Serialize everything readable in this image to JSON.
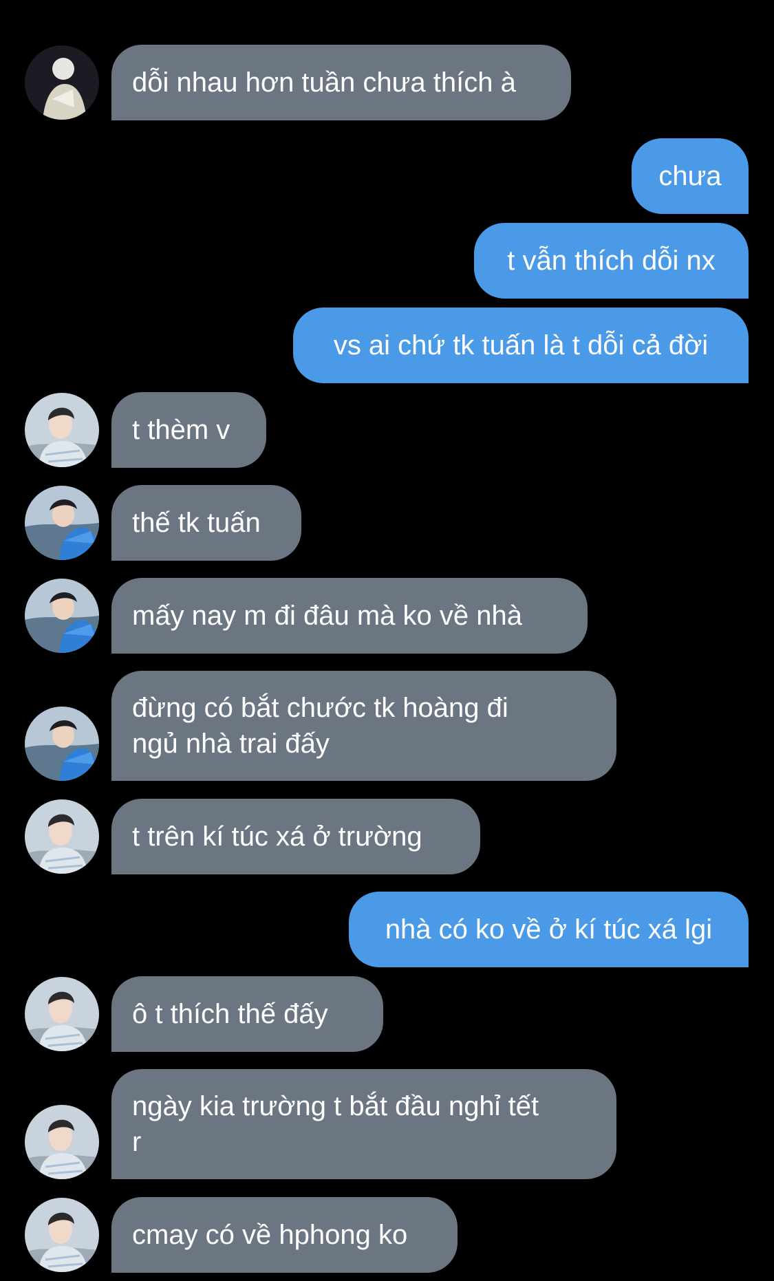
{
  "conversation": {
    "messages": [
      {
        "side": "in",
        "avatar": "avatar-a",
        "text": "dỗi nhau hơn tuần chưa thích à"
      },
      {
        "side": "out",
        "text": "chưa"
      },
      {
        "side": "out",
        "text": "t vẫn thích dỗi nx"
      },
      {
        "side": "out",
        "text": "vs ai chứ tk tuấn là t dỗi cả đời"
      },
      {
        "side": "in",
        "avatar": "avatar-b",
        "text": "t thèm v"
      },
      {
        "side": "in",
        "avatar": "avatar-c",
        "text": "thế tk tuấn"
      },
      {
        "side": "in",
        "avatar": "avatar-c",
        "text": "mấy nay m đi đâu mà ko về nhà"
      },
      {
        "side": "in",
        "avatar": "avatar-c",
        "text": "đừng có bắt chước tk hoàng đi\nngủ nhà trai đấy"
      },
      {
        "side": "in",
        "avatar": "avatar-b",
        "text": "t trên kí túc xá ở trường"
      },
      {
        "side": "out",
        "text": "nhà có ko về ở kí túc xá lgi"
      },
      {
        "side": "in",
        "avatar": "avatar-b",
        "text": "ô t thích thế đấy"
      },
      {
        "side": "in",
        "avatar": "avatar-b",
        "text": "ngày kia trường t bắt đầu nghỉ tết\nr"
      },
      {
        "side": "in",
        "avatar": "avatar-b",
        "text": "cmay có về hphong ko"
      }
    ]
  },
  "colors": {
    "background": "#000000",
    "incoming_bubble": "#6b7682",
    "outgoing_bubble": "#4a9ae8",
    "text": "#ffffff"
  }
}
